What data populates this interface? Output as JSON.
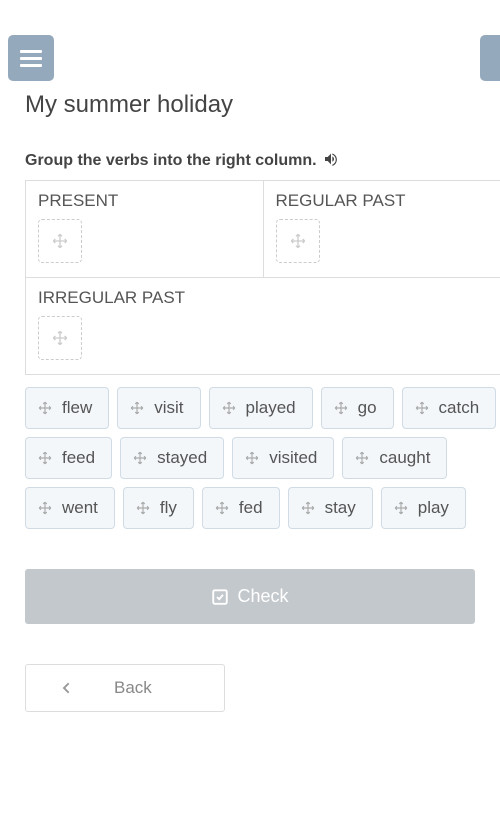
{
  "title": "My summer holiday",
  "instruction": "Group the verbs into the right column.",
  "columns": {
    "present": "PRESENT",
    "regular_past": "REGULAR PAST",
    "irregular_past": "IRREGULAR PAST"
  },
  "chips": [
    "flew",
    "visit",
    "played",
    "go",
    "catch",
    "feed",
    "stayed",
    "visited",
    "caught",
    "went",
    "fly",
    "fed",
    "stay",
    "play"
  ],
  "buttons": {
    "check": "Check",
    "back": "Back"
  }
}
